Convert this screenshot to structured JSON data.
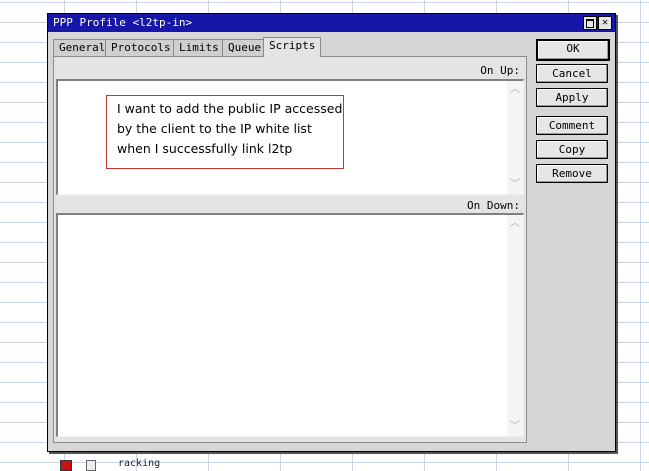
{
  "window": {
    "title": "PPP Profile <l2tp-in>"
  },
  "tabs": [
    {
      "label": "General"
    },
    {
      "label": "Protocols"
    },
    {
      "label": "Limits"
    },
    {
      "label": "Queue"
    },
    {
      "label": "Scripts",
      "active": true
    }
  ],
  "scripts": {
    "on_up_label": "On Up:",
    "on_down_label": "On Down:",
    "on_up_value": "",
    "on_down_value": ""
  },
  "annotation": {
    "lines": [
      "I want to add the public IP accessed",
      "by the client to the IP white list",
      "when I successfully link l2tp"
    ]
  },
  "buttons": {
    "ok": "OK",
    "cancel": "Cancel",
    "apply": "Apply",
    "comment": "Comment",
    "copy": "Copy",
    "remove": "Remove"
  },
  "background": {
    "visible_text": "racking"
  },
  "icons": {
    "maximize": "maximize-icon",
    "close": "close-icon",
    "scroll_up": "scroll-up-icon",
    "scroll_down": "scroll-down-icon"
  },
  "colors": {
    "titlebar": "#1616a8",
    "note_border": "#c0392b"
  }
}
